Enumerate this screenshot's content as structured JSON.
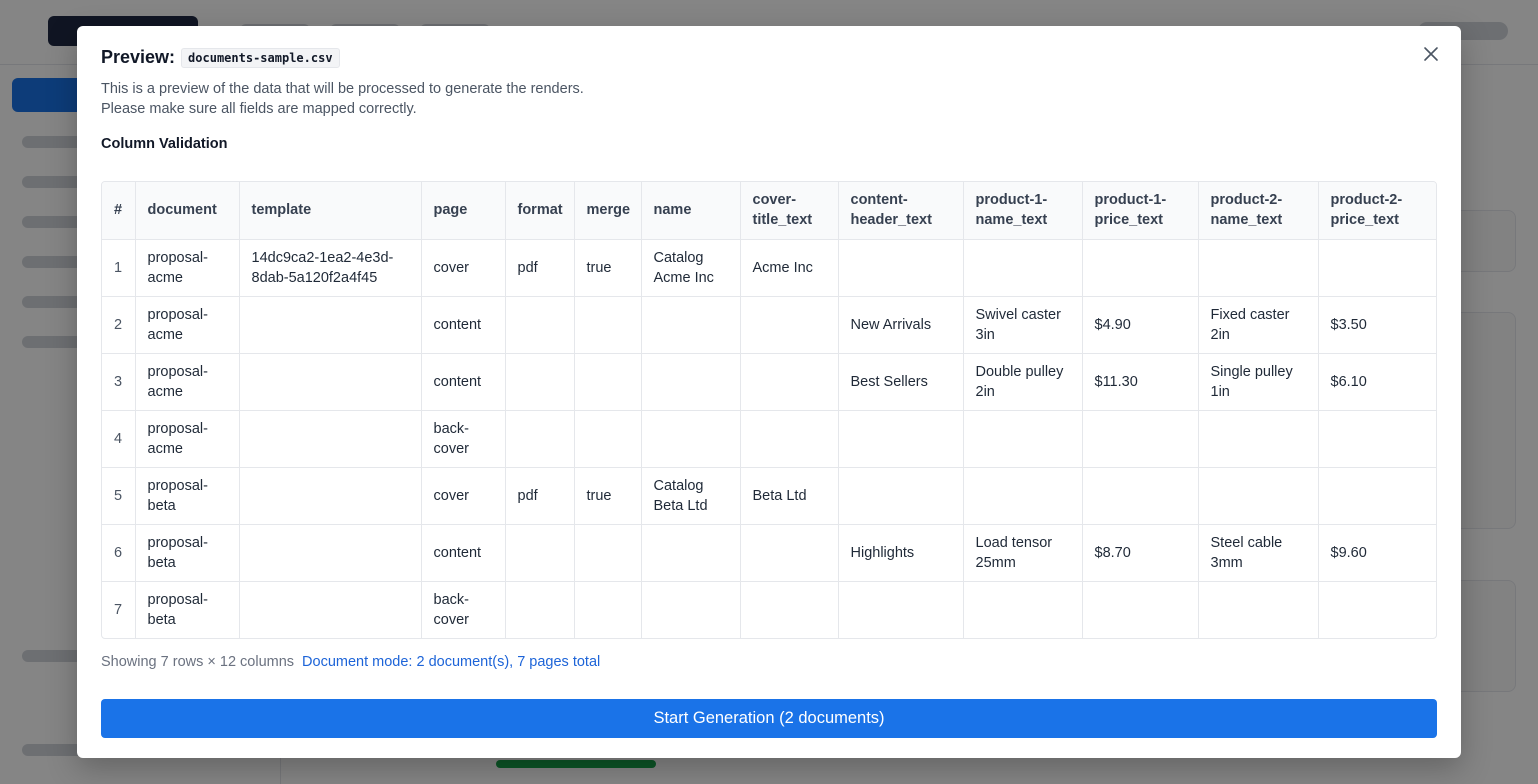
{
  "modal": {
    "title": "Preview:",
    "filename": "documents-sample.csv",
    "description_line1": "This is a preview of the data that will be processed to generate the renders.",
    "description_line2": "Please make sure all fields are mapped correctly.",
    "section_title": "Column Validation",
    "close_icon": "close-icon"
  },
  "table": {
    "headers": [
      "#",
      "document",
      "template",
      "page",
      "format",
      "merge",
      "name",
      "cover-title_text",
      "content-header_text",
      "product-1-name_text",
      "product-1-price_text",
      "product-2-name_text",
      "product-2-price_text"
    ],
    "rows": [
      [
        "1",
        "proposal-acme",
        "14dc9ca2-1ea2-4e3d-8dab-5a120f2a4f45",
        "cover",
        "pdf",
        "true",
        "Catalog Acme Inc",
        "Acme Inc",
        "",
        "",
        "",
        "",
        ""
      ],
      [
        "2",
        "proposal-acme",
        "",
        "content",
        "",
        "",
        "",
        "",
        "New Arrivals",
        "Swivel caster 3in",
        "$4.90",
        "Fixed caster 2in",
        "$3.50"
      ],
      [
        "3",
        "proposal-acme",
        "",
        "content",
        "",
        "",
        "",
        "",
        "Best Sellers",
        "Double pulley 2in",
        "$11.30",
        "Single pulley 1in",
        "$6.10"
      ],
      [
        "4",
        "proposal-acme",
        "",
        "back-cover",
        "",
        "",
        "",
        "",
        "",
        "",
        "",
        "",
        ""
      ],
      [
        "5",
        "proposal-beta",
        "",
        "cover",
        "pdf",
        "true",
        "Catalog Beta Ltd",
        "Beta Ltd",
        "",
        "",
        "",
        "",
        ""
      ],
      [
        "6",
        "proposal-beta",
        "",
        "content",
        "",
        "",
        "",
        "",
        "Highlights",
        "Load tensor 25mm",
        "$8.70",
        "Steel cable 3mm",
        "$9.60"
      ],
      [
        "7",
        "proposal-beta",
        "",
        "back-cover",
        "",
        "",
        "",
        "",
        "",
        "",
        "",
        "",
        ""
      ]
    ]
  },
  "footer": {
    "count_text": "Showing 7 rows × 12 columns",
    "mode_text": "Document mode: 2 document(s), 7 pages total",
    "start_label": "Start Generation (2 documents)"
  },
  "colors": {
    "accent": "#1a73e8",
    "link": "#1d64d8"
  }
}
